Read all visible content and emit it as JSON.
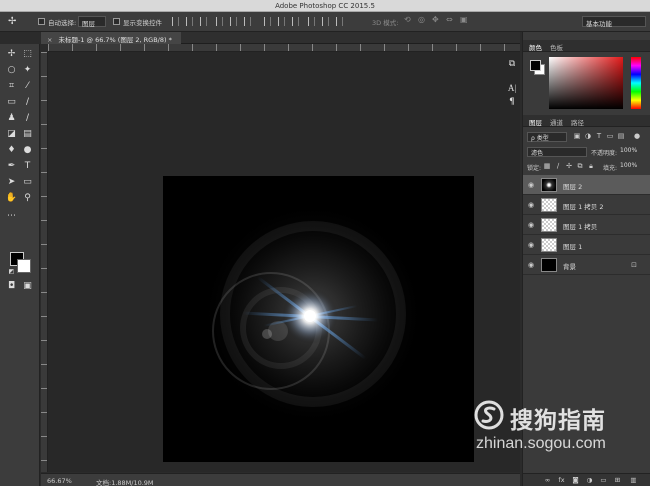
{
  "titlebar": {
    "title": "Adobe Photoshop CC 2015.5"
  },
  "options": {
    "move_icon": "move-icon",
    "auto_select_label": "自动选择:",
    "auto_select_value": "图层",
    "show_transform_label": "显示变换控件",
    "mode_3d_label": "3D 模式:",
    "workspace": "基本功能"
  },
  "document": {
    "tab_close": "×",
    "tab_title": "未标题-1 @ 66.7% (图层 2, RGB/8) *"
  },
  "status": {
    "zoom": "66.67%",
    "doc_info": "文档:1.88M/10.9M"
  },
  "color_panel": {
    "tabs": [
      "颜色",
      "色板"
    ],
    "fg": "#000000",
    "bg": "#ffffff",
    "hue": "#e21a1a"
  },
  "layers_panel": {
    "tabs": [
      "图层",
      "通道",
      "路径"
    ],
    "filter_type": "ρ 类型",
    "blend_mode": "滤色",
    "opacity_label": "不透明度:",
    "opacity": "100%",
    "lock_label": "锁定:",
    "fill_label": "填充:",
    "fill": "100%",
    "layers": [
      {
        "name": "图层 2",
        "thumb": "flare",
        "selected": true
      },
      {
        "name": "图层 1 拷贝 2",
        "thumb": "trans",
        "selected": false
      },
      {
        "name": "图层 1 拷贝",
        "thumb": "trans",
        "selected": false
      },
      {
        "name": "图层 1",
        "thumb": "trans",
        "selected": false
      },
      {
        "name": "背景",
        "thumb": "black",
        "selected": false,
        "locked": true
      }
    ],
    "footer_icons": [
      "link-icon",
      "fx-icon",
      "mask-icon",
      "adjustment-icon",
      "group-icon",
      "new-layer-icon",
      "trash-icon"
    ]
  },
  "watermark": {
    "name": "搜狗指南",
    "url": "zhinan.sogou.com"
  }
}
